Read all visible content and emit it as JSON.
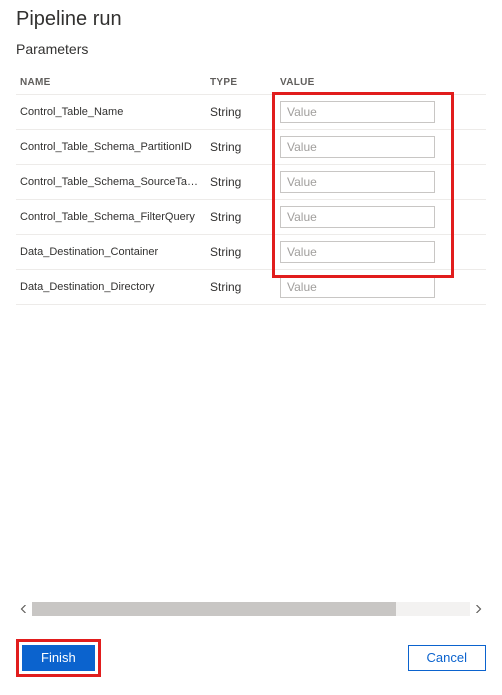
{
  "header": {
    "title": "Pipeline run",
    "subtitle": "Parameters"
  },
  "table": {
    "columns": {
      "name": "NAME",
      "type": "TYPE",
      "value": "VALUE"
    },
    "rows": [
      {
        "name": "Control_Table_Name",
        "type": "String",
        "placeholder": "Value"
      },
      {
        "name": "Control_Table_Schema_PartitionID",
        "type": "String",
        "placeholder": "Value"
      },
      {
        "name": "Control_Table_Schema_SourceTableName",
        "type": "String",
        "placeholder": "Value"
      },
      {
        "name": "Control_Table_Schema_FilterQuery",
        "type": "String",
        "placeholder": "Value"
      },
      {
        "name": "Data_Destination_Container",
        "type": "String",
        "placeholder": "Value"
      },
      {
        "name": "Data_Destination_Directory",
        "type": "String",
        "placeholder": "Value"
      }
    ]
  },
  "footer": {
    "finish": "Finish",
    "cancel": "Cancel"
  }
}
